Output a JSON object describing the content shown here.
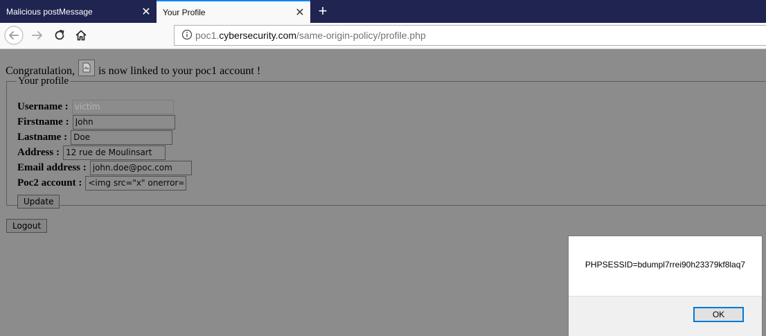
{
  "tabs": [
    {
      "title": "Malicious postMessage",
      "close": "✕"
    },
    {
      "title": "Your Profile",
      "close": "✕"
    }
  ],
  "new_tab_label": "+",
  "nav": {
    "back_icon": "back-arrow",
    "forward_icon": "forward-arrow",
    "reload_icon": "reload",
    "home_icon": "home"
  },
  "url": {
    "prefix": "poc1.",
    "domain": "cybersecurity.com",
    "path": "/same-origin-policy/profile.php"
  },
  "page": {
    "congrats_before": "Congratulation,",
    "congrats_after": "is now linked to your poc1 account !",
    "legend": "Your profile",
    "fields": {
      "username_label": "Username :",
      "username_value": "victim",
      "firstname_label": "Firstname :",
      "firstname_value": "John",
      "lastname_label": "Lastname :",
      "lastname_value": "Doe",
      "address_label": "Address :",
      "address_value": "12 rue de Moulinsart",
      "email_label": "Email address :",
      "email_value": "john.doe@poc.com",
      "poc2_label": "Poc2 account :",
      "poc2_value": "<img src=\"x\" onerror=\"a"
    },
    "update_label": "Update",
    "logout_label": "Logout"
  },
  "dialog": {
    "message": "PHPSESSID=bdumpl7rrei90h23379kf8laq7",
    "ok_label": "OK"
  },
  "colors": {
    "tab_strip": "#1f2450",
    "active_tab_accent": "#0a84ff",
    "overlay": "#8c8c8c",
    "ok_border": "#0078d7"
  }
}
